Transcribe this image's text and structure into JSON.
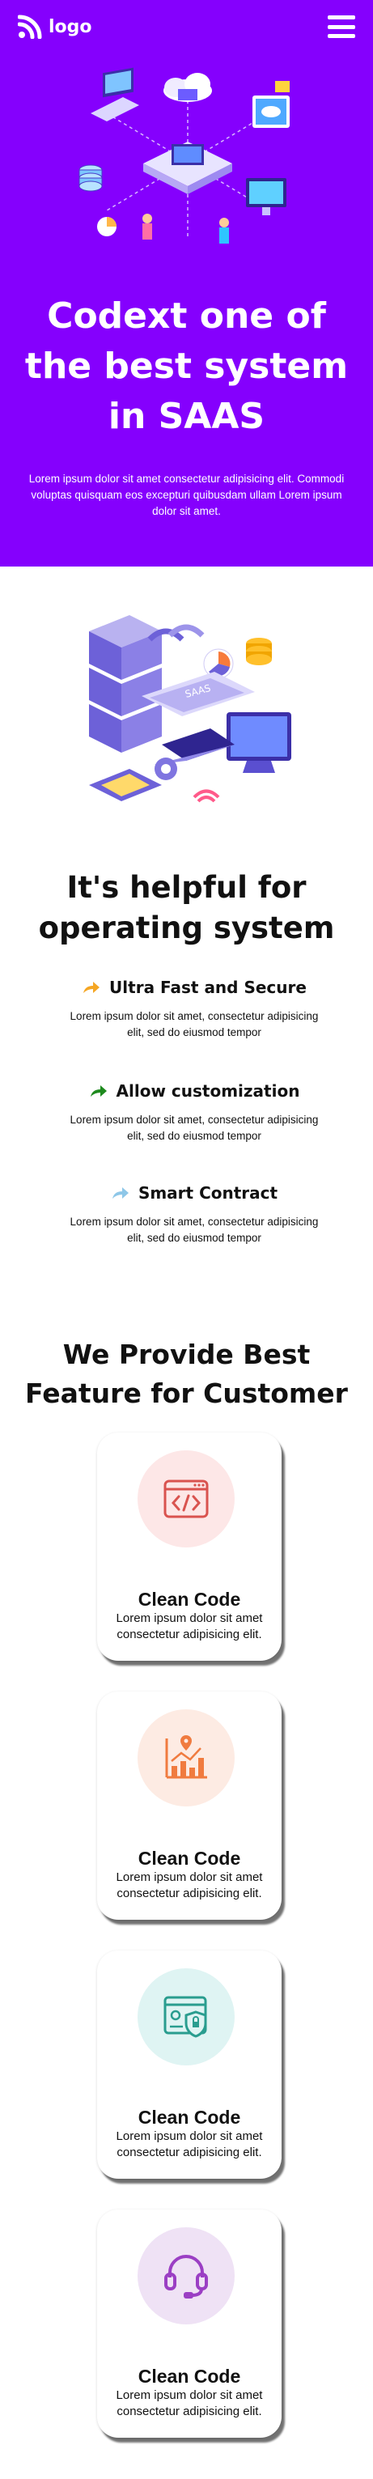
{
  "header": {
    "logo_text": "logo"
  },
  "hero": {
    "title": "Codext one of the best system in SAAS",
    "description": "Lorem ipsum dolor sit amet consectetur adipisicing elit. Commodi voluptas quisquam eos excepturi quibusdam ullam Lorem ipsum dolor sit amet."
  },
  "about": {
    "title": "It's helpful for operating system",
    "features": [
      {
        "title": "Ultra Fast and Secure",
        "text": "Lorem ipsum dolor sit amet, consectetur adipisicing elit, sed do eiusmod tempor",
        "icon": "arrow-forward-icon",
        "color": "#f5a623"
      },
      {
        "title": "Allow customization",
        "text": "Lorem ipsum dolor sit amet, consectetur adipisicing elit, sed do eiusmod tempor",
        "icon": "arrow-forward-icon",
        "color": "#1e8a1e"
      },
      {
        "title": "Smart Contract",
        "text": "Lorem ipsum dolor sit amet, consectetur adipisicing elit, sed do eiusmod tempor",
        "icon": "arrow-forward-icon",
        "color": "#8ec7e8"
      }
    ]
  },
  "services": {
    "title": "We Provide Best Feature for Customer",
    "cards": [
      {
        "title": "Clean Code",
        "text": "Lorem ipsum dolor sit amet consectetur adipisicing elit.",
        "icon": "code-window-icon",
        "bg": "#fde7e7",
        "color": "#d9534f"
      },
      {
        "title": "Clean Code",
        "text": "Lorem ipsum dolor sit amet consectetur adipisicing elit.",
        "icon": "growth-chart-icon",
        "bg": "#fdebe3",
        "color": "#f07b3f"
      },
      {
        "title": "Clean Code",
        "text": "Lorem ipsum dolor sit amet consectetur adipisicing elit.",
        "icon": "secure-profile-icon",
        "bg": "#dff4f3",
        "color": "#2a9d8f"
      },
      {
        "title": "Clean Code",
        "text": "Lorem ipsum dolor sit amet consectetur adipisicing elit.",
        "icon": "headset-icon",
        "bg": "#efe2f5",
        "color": "#9b3fc4"
      }
    ]
  },
  "colors": {
    "hero_bg": "#8500fd",
    "text": "#111111",
    "white": "#ffffff"
  }
}
